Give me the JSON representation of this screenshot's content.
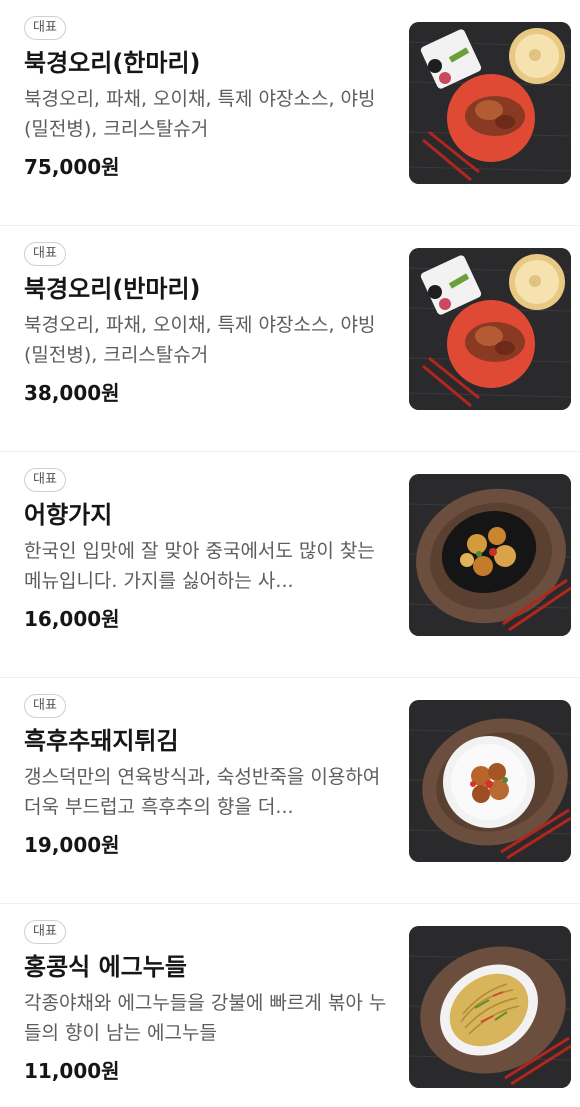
{
  "menu": {
    "items": [
      {
        "badge": "대표",
        "name": "북경오리(한마리)",
        "description": "북경오리, 파채, 오이채, 특제 야장소스, 야빙(밀전병), 크리스탈슈거",
        "price": "75,000원",
        "image_icon": "peking-duck-photo"
      },
      {
        "badge": "대표",
        "name": "북경오리(반마리)",
        "description": "북경오리, 파채, 오이채, 특제 야장소스, 야빙(밀전병), 크리스탈슈거",
        "price": "38,000원",
        "image_icon": "peking-duck-photo"
      },
      {
        "badge": "대표",
        "name": "어향가지",
        "description": "한국인 입맛에 잘 맞아 중국에서도 많이 찾는 메뉴입니다. 가지를 싫어하는 사...",
        "price": "16,000원",
        "image_icon": "eggplant-dish-photo"
      },
      {
        "badge": "대표",
        "name": "흑후추돼지튀김",
        "description": "갱스덕만의 연육방식과, 숙성반죽을 이용하여 더욱 부드럽고 흑후추의 향을 더...",
        "price": "19,000원",
        "image_icon": "fried-pork-photo"
      },
      {
        "badge": "대표",
        "name": "홍콩식 에그누들",
        "description": "각종야채와 에그누들을 강불에 빠르게 볶아 누들의 향이 남는 에그누들",
        "price": "11,000원",
        "image_icon": "egg-noodle-photo"
      }
    ]
  }
}
